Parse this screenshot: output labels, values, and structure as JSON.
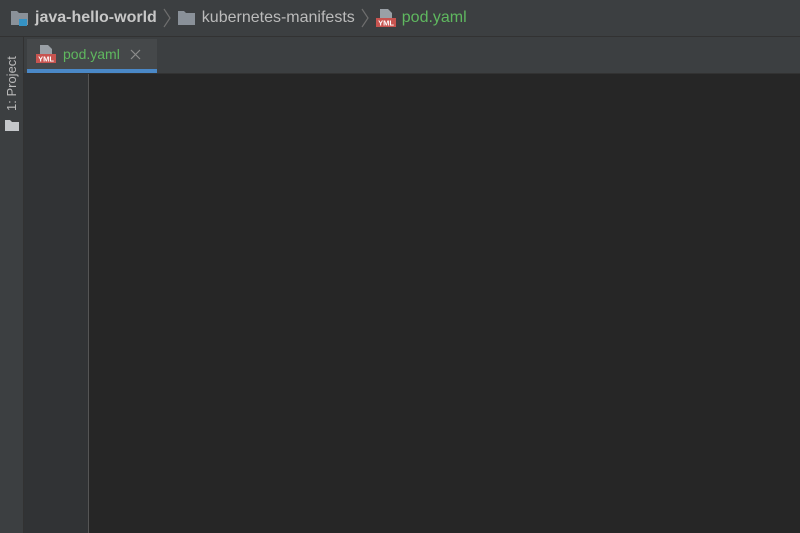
{
  "breadcrumb": {
    "project": "java-hello-world",
    "folder": "kubernetes-manifests",
    "file": "pod.yaml",
    "file_icon_text": "YML"
  },
  "tool_window": {
    "project_label": "1: Project"
  },
  "tabs": [
    {
      "label": "pod.yaml",
      "icon_text": "YML",
      "active": true
    }
  ],
  "colors": {
    "accent": "#4a88c7",
    "file_name": "#5fb85f",
    "yaml_icon": "#c75450"
  }
}
